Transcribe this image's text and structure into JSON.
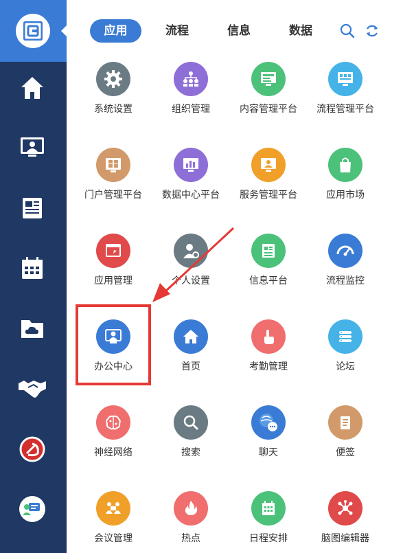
{
  "tabs": [
    {
      "label": "应用",
      "active": true
    },
    {
      "label": "流程",
      "active": false
    },
    {
      "label": "信息",
      "active": false
    },
    {
      "label": "数据",
      "active": false
    }
  ],
  "colors": {
    "sidebar": "#1f3864",
    "accent": "#3a7bd5",
    "highlight": "#e53935"
  },
  "sidebar_icons": [
    "logo-icon",
    "home-icon",
    "monitor-user-icon",
    "news-icon",
    "calendar-icon",
    "cloud-folder-icon",
    "handshake-icon",
    "party-emblem-icon",
    "support-chat-icon"
  ],
  "apps": [
    {
      "label": "系统设置",
      "icon": "gear-icon",
      "color": "#6b7b83"
    },
    {
      "label": "组织管理",
      "icon": "org-chart-icon",
      "color": "#8e6fd8"
    },
    {
      "label": "内容管理平台",
      "icon": "content-screen-icon",
      "color": "#4cc17a"
    },
    {
      "label": "流程管理平台",
      "icon": "process-screen-icon",
      "color": "#45b3e7"
    },
    {
      "label": "门户管理平台",
      "icon": "portal-grid-icon",
      "color": "#d29a6a"
    },
    {
      "label": "数据中心平台",
      "icon": "data-chart-icon",
      "color": "#8e6fd8"
    },
    {
      "label": "服务管理平台",
      "icon": "service-screen-icon",
      "color": "#f0a028"
    },
    {
      "label": "应用市场",
      "icon": "shopping-bag-icon",
      "color": "#4cc17a"
    },
    {
      "label": "应用管理",
      "icon": "app-window-icon",
      "color": "#e04a4a"
    },
    {
      "label": "个人设置",
      "icon": "user-gear-icon",
      "color": "#6b7b83"
    },
    {
      "label": "信息平台",
      "icon": "info-doc-icon",
      "color": "#4cc17a"
    },
    {
      "label": "流程监控",
      "icon": "speedometer-icon",
      "color": "#3a7bd5"
    },
    {
      "label": "办公中心",
      "icon": "office-user-icon",
      "color": "#3a7bd5"
    },
    {
      "label": "首页",
      "icon": "home-icon",
      "color": "#3a7bd5"
    },
    {
      "label": "考勤管理",
      "icon": "finger-touch-icon",
      "color": "#f06e6e"
    },
    {
      "label": "论坛",
      "icon": "forum-list-icon",
      "color": "#45b3e7"
    },
    {
      "label": "神经网络",
      "icon": "brain-icon",
      "color": "#f06e6e"
    },
    {
      "label": "搜索",
      "icon": "search-icon",
      "color": "#6b7b83"
    },
    {
      "label": "聊天",
      "icon": "chat-bubble-icon",
      "color": "#3a7bd5"
    },
    {
      "label": "便签",
      "icon": "note-icon",
      "color": "#d29a6a"
    },
    {
      "label": "会议管理",
      "icon": "meeting-icon",
      "color": "#f0a028"
    },
    {
      "label": "热点",
      "icon": "fire-icon",
      "color": "#f06e6e"
    },
    {
      "label": "日程安排",
      "icon": "schedule-icon",
      "color": "#4cc17a"
    },
    {
      "label": "脑图编辑器",
      "icon": "mindmap-icon",
      "color": "#e04a4a"
    }
  ]
}
